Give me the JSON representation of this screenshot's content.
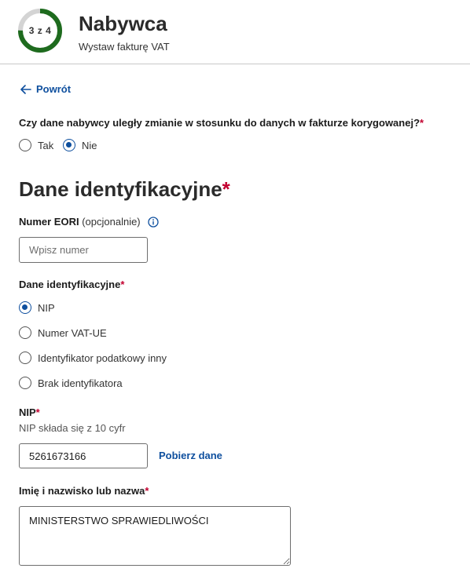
{
  "header": {
    "progress_label": "3 z 4",
    "progress_fraction": 0.75,
    "title": "Nabywca",
    "subtitle": "Wystaw fakturę VAT"
  },
  "nav": {
    "back_label": "Powrót"
  },
  "question": {
    "text": "Czy dane nabywcy uległy zmianie w stosunku do danych w fakturze korygowanej?",
    "required_mark": "*",
    "options": [
      {
        "label": "Tak",
        "checked": false
      },
      {
        "label": "Nie",
        "checked": true
      }
    ]
  },
  "section": {
    "title": "Dane identyfikacyjne",
    "required_mark": "*"
  },
  "eori": {
    "label": "Numer EORI",
    "optional_note": "(opcjonalnie)",
    "placeholder": "Wpisz numer",
    "value": ""
  },
  "id_type": {
    "label": "Dane identyfikacyjne",
    "required_mark": "*",
    "options": [
      {
        "label": "NIP",
        "checked": true
      },
      {
        "label": "Numer VAT-UE",
        "checked": false
      },
      {
        "label": "Identyfikator podatkowy inny",
        "checked": false
      },
      {
        "label": "Brak identyfikatora",
        "checked": false
      }
    ]
  },
  "nip": {
    "label": "NIP",
    "required_mark": "*",
    "hint": "NIP składa się z 10 cyfr",
    "value": "5261673166",
    "fetch_label": "Pobierz dane"
  },
  "name_field": {
    "label": "Imię i nazwisko lub nazwa",
    "required_mark": "*",
    "value": "MINISTERSTWO SPRAWIEDLIWOŚCI"
  },
  "colors": {
    "progress_done": "#1e6b1e",
    "progress_track": "#d4d4d4",
    "link": "#0e4f9e",
    "required": "#c2002f"
  }
}
